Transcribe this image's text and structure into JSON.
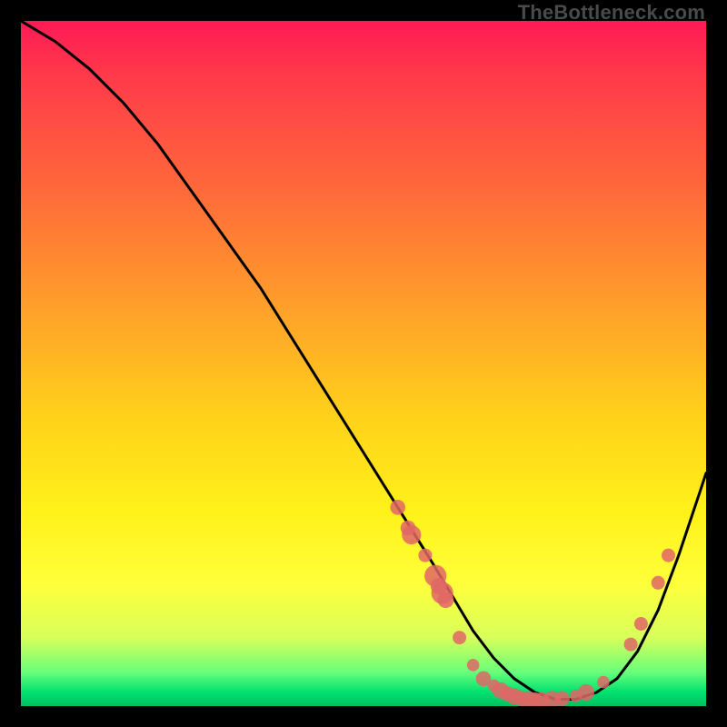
{
  "watermark": "TheBottleneck.com",
  "chart_data": {
    "type": "line",
    "title": "",
    "xlabel": "",
    "ylabel": "",
    "xlim": [
      0,
      100
    ],
    "ylim": [
      0,
      100
    ],
    "series": [
      {
        "name": "curve",
        "x": [
          0,
          5,
          10,
          15,
          20,
          25,
          30,
          35,
          40,
          45,
          50,
          55,
          60,
          63,
          66,
          69,
          72,
          75,
          78,
          81,
          84,
          87,
          90,
          93,
          96,
          99,
          100
        ],
        "y": [
          100,
          97,
          93,
          88,
          82,
          75,
          68,
          61,
          53,
          45,
          37,
          29,
          21,
          16,
          11,
          7,
          4,
          2,
          1,
          1,
          2,
          4,
          8,
          14,
          22,
          31,
          34
        ]
      }
    ],
    "point_overlay": {
      "name": "markers",
      "color": "#e06666",
      "points": [
        {
          "x": 55,
          "y": 29,
          "r": 1.1
        },
        {
          "x": 56.5,
          "y": 26,
          "r": 1.1
        },
        {
          "x": 57,
          "y": 25,
          "r": 1.4
        },
        {
          "x": 59,
          "y": 22,
          "r": 1.0
        },
        {
          "x": 60.5,
          "y": 19,
          "r": 1.6
        },
        {
          "x": 61,
          "y": 17.5,
          "r": 1.2
        },
        {
          "x": 61.5,
          "y": 16.5,
          "r": 1.6
        },
        {
          "x": 62,
          "y": 15.5,
          "r": 1.2
        },
        {
          "x": 64,
          "y": 10,
          "r": 1.0
        },
        {
          "x": 66,
          "y": 6,
          "r": 0.9
        },
        {
          "x": 67.5,
          "y": 4,
          "r": 1.1
        },
        {
          "x": 69,
          "y": 3,
          "r": 0.9
        },
        {
          "x": 70,
          "y": 2.3,
          "r": 1.2
        },
        {
          "x": 71,
          "y": 1.8,
          "r": 1.1
        },
        {
          "x": 72,
          "y": 1.4,
          "r": 1.2
        },
        {
          "x": 73,
          "y": 1.1,
          "r": 1.1
        },
        {
          "x": 74,
          "y": 1.0,
          "r": 1.2
        },
        {
          "x": 75,
          "y": 0.9,
          "r": 1.1
        },
        {
          "x": 76,
          "y": 0.9,
          "r": 1.1
        },
        {
          "x": 77.5,
          "y": 0.9,
          "r": 1.3
        },
        {
          "x": 79,
          "y": 1.1,
          "r": 1.1
        },
        {
          "x": 81,
          "y": 1.5,
          "r": 0.9
        },
        {
          "x": 82.5,
          "y": 2.0,
          "r": 1.2
        },
        {
          "x": 85,
          "y": 3.5,
          "r": 0.9
        },
        {
          "x": 89,
          "y": 9,
          "r": 1.0
        },
        {
          "x": 90.5,
          "y": 12,
          "r": 1.0
        },
        {
          "x": 93,
          "y": 18,
          "r": 1.0
        },
        {
          "x": 94.5,
          "y": 22,
          "r": 1.0
        }
      ]
    }
  }
}
